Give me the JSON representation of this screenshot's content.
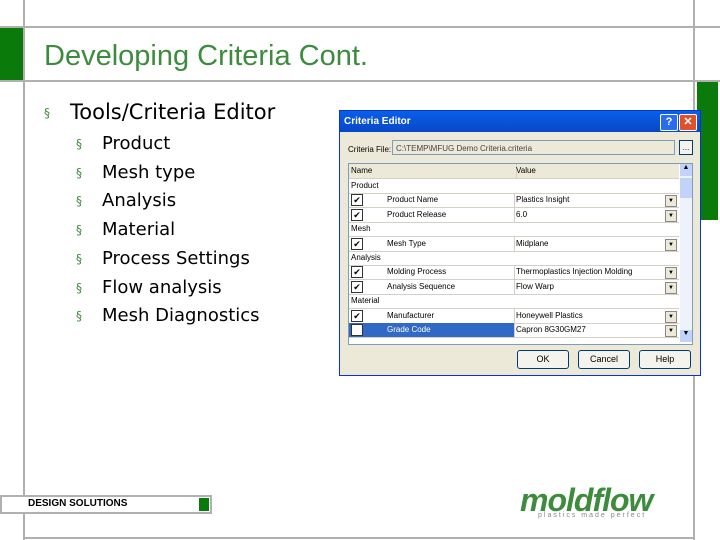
{
  "slide": {
    "title": "Developing Criteria Cont.",
    "main_bullet": "Tools/Criteria Editor",
    "sub_bullets": [
      "Product",
      "Mesh type",
      "Analysis",
      "Material",
      "Process Settings",
      "Flow analysis",
      "Mesh Diagnostics"
    ],
    "footer": "DESIGN SOLUTIONS",
    "logo": "moldflow",
    "logo_tagline": "plastics made perfect",
    "bullet_char": "§"
  },
  "dialog": {
    "title": "Criteria Editor",
    "help": "?",
    "close": "✕",
    "file_label": "Criteria File:",
    "file_value": "C:\\TEMP\\MFUG Demo Criteria.criteria",
    "browse": "...",
    "col_name": "Name",
    "col_value": "Value",
    "rows": [
      {
        "type": "group",
        "name": "Product"
      },
      {
        "type": "item",
        "name": "Product Name",
        "value": "Plastics Insight"
      },
      {
        "type": "item",
        "name": "Product Release",
        "value": "6.0"
      },
      {
        "type": "group",
        "name": "Mesh"
      },
      {
        "type": "item",
        "name": "Mesh Type",
        "value": "Midplane"
      },
      {
        "type": "group",
        "name": "Analysis"
      },
      {
        "type": "item",
        "name": "Molding Process",
        "value": "Thermoplastics Injection Molding"
      },
      {
        "type": "item",
        "name": "Analysis Sequence",
        "value": "Flow Warp"
      },
      {
        "type": "group",
        "name": "Material"
      },
      {
        "type": "item",
        "name": "Manufacturer",
        "value": "Honeywell Plastics"
      },
      {
        "type": "item",
        "name": "Grade Code",
        "value": "Capron 8G30GM27",
        "selected": true
      }
    ],
    "ok": "OK",
    "cancel": "Cancel",
    "help_btn": "Help"
  },
  "colors": {
    "green": "#0a7a0a",
    "title_green": "#3d8c3d",
    "select": "#316ac5"
  }
}
